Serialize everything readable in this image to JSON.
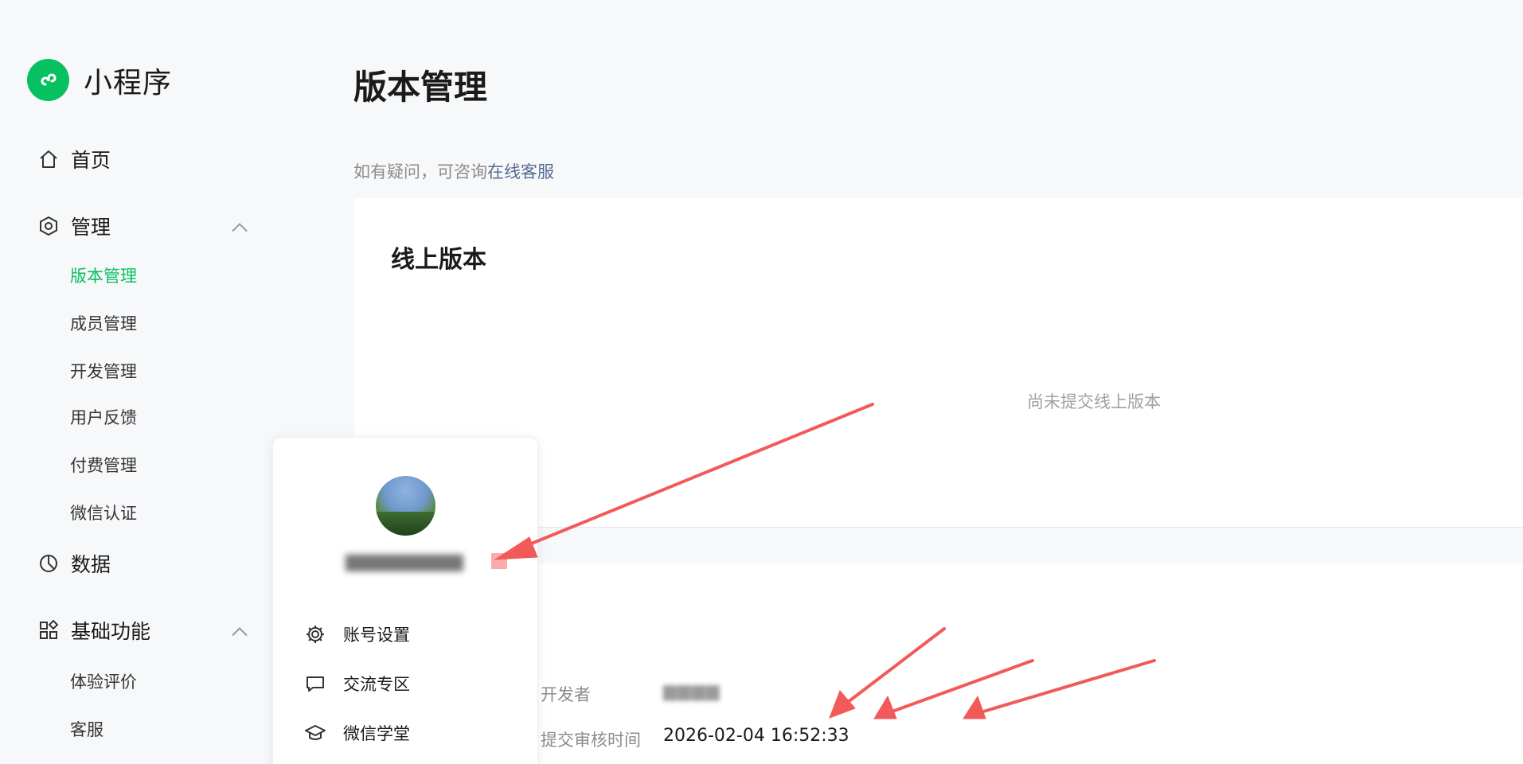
{
  "app": {
    "name": "小程序",
    "logo_color": "#07c160"
  },
  "sidebar": {
    "home": {
      "label": "首页",
      "icon": "home-icon"
    },
    "manage": {
      "label": "管理",
      "icon": "settings-hexagon-icon",
      "expanded": true,
      "items": [
        {
          "label": "版本管理",
          "active": true
        },
        {
          "label": "成员管理"
        },
        {
          "label": "开发管理"
        },
        {
          "label": "用户反馈"
        },
        {
          "label": "付费管理"
        },
        {
          "label": "微信认证"
        }
      ]
    },
    "data": {
      "label": "数据",
      "icon": "pie-chart-icon"
    },
    "basic": {
      "label": "基础功能",
      "icon": "grid-apps-icon",
      "expanded": true,
      "items": [
        {
          "label": "体验评价"
        },
        {
          "label": "客服"
        }
      ]
    }
  },
  "main": {
    "title": "版本管理",
    "help_prefix": "如有疑问，可咨询",
    "help_link": "在线客服",
    "online": {
      "title": "线上版本",
      "empty_text": "尚未提交线上版本"
    },
    "review": {
      "developer_label": "开发者",
      "developer_value": "▆▆▆▆",
      "submit_time_label": "提交审核时间",
      "submit_time_value": "2026-02-04 16:52:33"
    }
  },
  "popup": {
    "username": "▆▆▆▆▆▆▆▆",
    "menu": [
      {
        "label": "账号设置",
        "icon": "gear-icon"
      },
      {
        "label": "交流专区",
        "icon": "chat-bubble-icon"
      },
      {
        "label": "微信学堂",
        "icon": "graduation-cap-icon"
      }
    ]
  },
  "colors": {
    "accent": "#07c160",
    "link": "#576b95",
    "annotation_arrow": "#f25a5a"
  }
}
